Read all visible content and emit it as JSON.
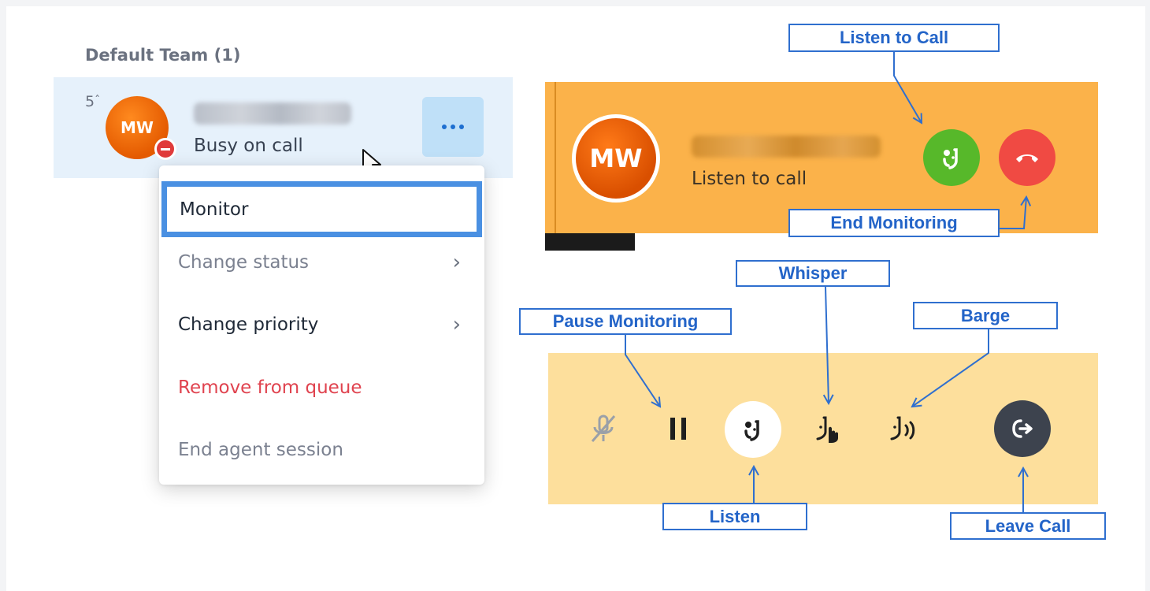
{
  "team": {
    "title": "Default Team (1)",
    "agent": {
      "priority": "5",
      "initials": "MW",
      "status": "Busy on call"
    }
  },
  "menu": {
    "items": [
      {
        "label": "Monitor"
      },
      {
        "label": "Change status"
      },
      {
        "label": "Change priority"
      },
      {
        "label": "Remove from queue"
      },
      {
        "label": "End agent session"
      }
    ]
  },
  "banner": {
    "initials": "MW",
    "status": "Listen to call"
  },
  "callouts": {
    "listen_to_call": "Listen to Call",
    "end_monitoring": "End Monitoring",
    "whisper": "Whisper",
    "pause_monitoring": "Pause Monitoring",
    "barge": "Barge",
    "listen": "Listen",
    "leave_call": "Leave Call"
  },
  "colors": {
    "banner_bg": "#fbb24a",
    "controls_bg": "#fddf9c",
    "callout_border": "#2f6fcf",
    "highlight_border": "#4a90e2",
    "danger_text": "#e0434f",
    "listen_button": "#57b82a",
    "end_button": "#f04a43",
    "leave_button": "#3d434e"
  },
  "icons": {
    "mute": "microphone-off-icon",
    "pause": "pause-icon",
    "listen": "headset-listen-icon",
    "whisper": "whisper-icon",
    "barge": "barge-icon",
    "leave": "leave-call-icon",
    "end": "hang-up-icon"
  }
}
